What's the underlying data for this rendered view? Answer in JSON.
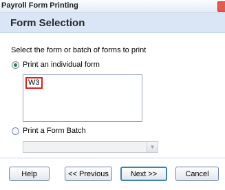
{
  "window": {
    "title": "Payroll Form Printing"
  },
  "header": {
    "title": "Form Selection"
  },
  "instruction": "Select the form or batch of forms to print",
  "options": {
    "individual": {
      "label": "Print an individual form",
      "selected": true
    },
    "batch": {
      "label": "Print a Form Batch",
      "selected": false
    }
  },
  "form_list": {
    "items": [
      "W3"
    ],
    "selected_index": 0
  },
  "batch_select": {
    "value": ""
  },
  "buttons": {
    "help": "Help",
    "previous": "<< Previous",
    "next": "Next >>",
    "cancel": "Cancel"
  },
  "icons": {
    "close": "close-icon",
    "dropdown": "chevron-down-icon"
  }
}
